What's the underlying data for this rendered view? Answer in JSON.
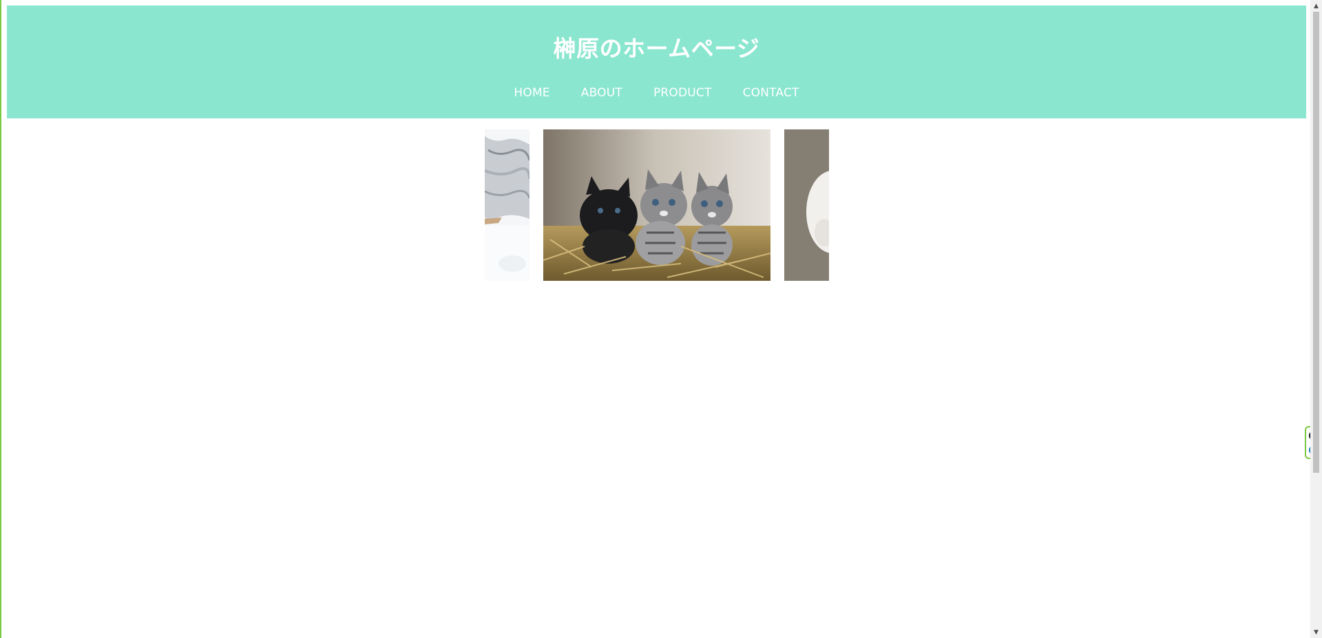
{
  "header": {
    "title": "榊原のホームページ",
    "nav": [
      {
        "label": "HOME"
      },
      {
        "label": "ABOUT"
      },
      {
        "label": "PRODUCT"
      },
      {
        "label": "CONTACT"
      }
    ]
  },
  "slider": {
    "slides": [
      {
        "name": "snow-slide",
        "state": "partial"
      },
      {
        "name": "kittens-slide",
        "state": "active"
      },
      {
        "name": "white-cat-slide",
        "state": "partial"
      }
    ]
  },
  "widget": {
    "icons": [
      "close-icon",
      "e-icon"
    ],
    "e_label": "e"
  },
  "colors": {
    "header_bg": "#8ae6cf",
    "accent_border": "#7ac943",
    "text_on_header": "#ffffff"
  }
}
